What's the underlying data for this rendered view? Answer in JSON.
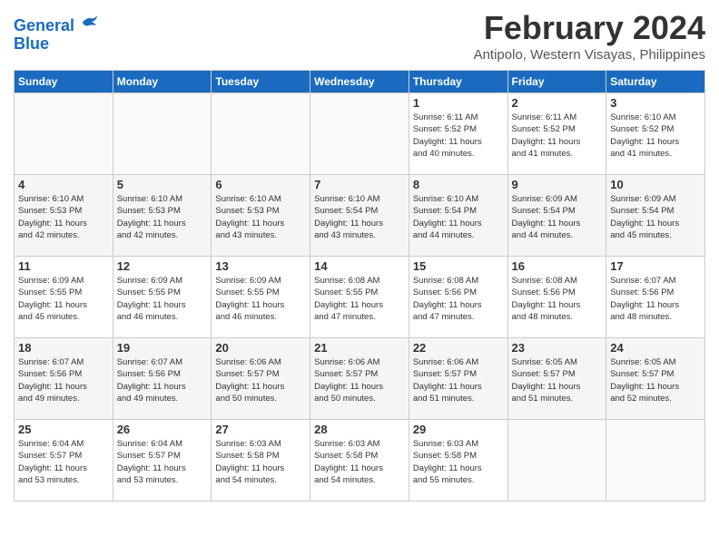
{
  "header": {
    "logo_line1": "General",
    "logo_line2": "Blue",
    "title": "February 2024",
    "subtitle": "Antipolo, Western Visayas, Philippines"
  },
  "days_of_week": [
    "Sunday",
    "Monday",
    "Tuesday",
    "Wednesday",
    "Thursday",
    "Friday",
    "Saturday"
  ],
  "weeks": [
    [
      {
        "day": "",
        "info": ""
      },
      {
        "day": "",
        "info": ""
      },
      {
        "day": "",
        "info": ""
      },
      {
        "day": "",
        "info": ""
      },
      {
        "day": "1",
        "info": "Sunrise: 6:11 AM\nSunset: 5:52 PM\nDaylight: 11 hours\nand 40 minutes."
      },
      {
        "day": "2",
        "info": "Sunrise: 6:11 AM\nSunset: 5:52 PM\nDaylight: 11 hours\nand 41 minutes."
      },
      {
        "day": "3",
        "info": "Sunrise: 6:10 AM\nSunset: 5:52 PM\nDaylight: 11 hours\nand 41 minutes."
      }
    ],
    [
      {
        "day": "4",
        "info": "Sunrise: 6:10 AM\nSunset: 5:53 PM\nDaylight: 11 hours\nand 42 minutes."
      },
      {
        "day": "5",
        "info": "Sunrise: 6:10 AM\nSunset: 5:53 PM\nDaylight: 11 hours\nand 42 minutes."
      },
      {
        "day": "6",
        "info": "Sunrise: 6:10 AM\nSunset: 5:53 PM\nDaylight: 11 hours\nand 43 minutes."
      },
      {
        "day": "7",
        "info": "Sunrise: 6:10 AM\nSunset: 5:54 PM\nDaylight: 11 hours\nand 43 minutes."
      },
      {
        "day": "8",
        "info": "Sunrise: 6:10 AM\nSunset: 5:54 PM\nDaylight: 11 hours\nand 44 minutes."
      },
      {
        "day": "9",
        "info": "Sunrise: 6:09 AM\nSunset: 5:54 PM\nDaylight: 11 hours\nand 44 minutes."
      },
      {
        "day": "10",
        "info": "Sunrise: 6:09 AM\nSunset: 5:54 PM\nDaylight: 11 hours\nand 45 minutes."
      }
    ],
    [
      {
        "day": "11",
        "info": "Sunrise: 6:09 AM\nSunset: 5:55 PM\nDaylight: 11 hours\nand 45 minutes."
      },
      {
        "day": "12",
        "info": "Sunrise: 6:09 AM\nSunset: 5:55 PM\nDaylight: 11 hours\nand 46 minutes."
      },
      {
        "day": "13",
        "info": "Sunrise: 6:09 AM\nSunset: 5:55 PM\nDaylight: 11 hours\nand 46 minutes."
      },
      {
        "day": "14",
        "info": "Sunrise: 6:08 AM\nSunset: 5:55 PM\nDaylight: 11 hours\nand 47 minutes."
      },
      {
        "day": "15",
        "info": "Sunrise: 6:08 AM\nSunset: 5:56 PM\nDaylight: 11 hours\nand 47 minutes."
      },
      {
        "day": "16",
        "info": "Sunrise: 6:08 AM\nSunset: 5:56 PM\nDaylight: 11 hours\nand 48 minutes."
      },
      {
        "day": "17",
        "info": "Sunrise: 6:07 AM\nSunset: 5:56 PM\nDaylight: 11 hours\nand 48 minutes."
      }
    ],
    [
      {
        "day": "18",
        "info": "Sunrise: 6:07 AM\nSunset: 5:56 PM\nDaylight: 11 hours\nand 49 minutes."
      },
      {
        "day": "19",
        "info": "Sunrise: 6:07 AM\nSunset: 5:56 PM\nDaylight: 11 hours\nand 49 minutes."
      },
      {
        "day": "20",
        "info": "Sunrise: 6:06 AM\nSunset: 5:57 PM\nDaylight: 11 hours\nand 50 minutes."
      },
      {
        "day": "21",
        "info": "Sunrise: 6:06 AM\nSunset: 5:57 PM\nDaylight: 11 hours\nand 50 minutes."
      },
      {
        "day": "22",
        "info": "Sunrise: 6:06 AM\nSunset: 5:57 PM\nDaylight: 11 hours\nand 51 minutes."
      },
      {
        "day": "23",
        "info": "Sunrise: 6:05 AM\nSunset: 5:57 PM\nDaylight: 11 hours\nand 51 minutes."
      },
      {
        "day": "24",
        "info": "Sunrise: 6:05 AM\nSunset: 5:57 PM\nDaylight: 11 hours\nand 52 minutes."
      }
    ],
    [
      {
        "day": "25",
        "info": "Sunrise: 6:04 AM\nSunset: 5:57 PM\nDaylight: 11 hours\nand 53 minutes."
      },
      {
        "day": "26",
        "info": "Sunrise: 6:04 AM\nSunset: 5:57 PM\nDaylight: 11 hours\nand 53 minutes."
      },
      {
        "day": "27",
        "info": "Sunrise: 6:03 AM\nSunset: 5:58 PM\nDaylight: 11 hours\nand 54 minutes."
      },
      {
        "day": "28",
        "info": "Sunrise: 6:03 AM\nSunset: 5:58 PM\nDaylight: 11 hours\nand 54 minutes."
      },
      {
        "day": "29",
        "info": "Sunrise: 6:03 AM\nSunset: 5:58 PM\nDaylight: 11 hours\nand 55 minutes."
      },
      {
        "day": "",
        "info": ""
      },
      {
        "day": "",
        "info": ""
      }
    ]
  ]
}
